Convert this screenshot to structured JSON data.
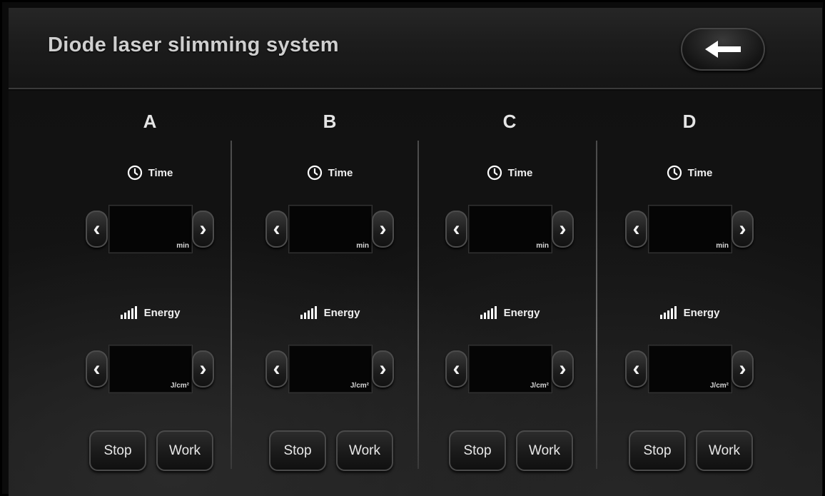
{
  "header": {
    "title": "Diode laser slimming system",
    "back_icon": "arrow-left-icon"
  },
  "labels": {
    "time": "Time",
    "energy": "Energy",
    "time_unit": "min",
    "energy_unit": "J/cm²",
    "stop": "Stop",
    "work": "Work"
  },
  "icons": {
    "time": "clock-icon",
    "energy": "signal-bars-icon",
    "decrease": "chevron-left-icon",
    "increase": "chevron-right-icon"
  },
  "channels": [
    {
      "name": "A",
      "time_value": "",
      "energy_value": ""
    },
    {
      "name": "B",
      "time_value": "",
      "energy_value": ""
    },
    {
      "name": "C",
      "time_value": "",
      "energy_value": ""
    },
    {
      "name": "D",
      "time_value": "",
      "energy_value": ""
    }
  ],
  "colors": {
    "background": "#0b0b0b",
    "text": "#e5e5e5"
  }
}
